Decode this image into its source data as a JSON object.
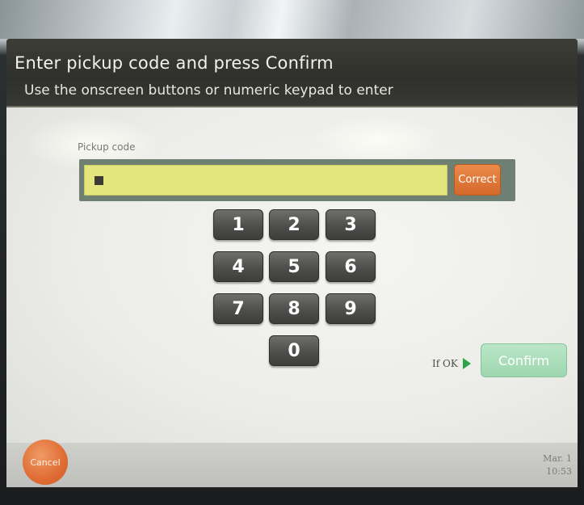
{
  "header": {
    "title": "Enter pickup code and press Confirm",
    "subtitle": "Use the onscreen buttons or numeric keypad to enter"
  },
  "pickup": {
    "label": "Pickup code",
    "value": "",
    "correct_label": "Correct"
  },
  "keypad": {
    "keys": [
      "1",
      "2",
      "3",
      "4",
      "5",
      "6",
      "7",
      "8",
      "9",
      "0"
    ]
  },
  "actions": {
    "if_ok_label": "If OK",
    "confirm_label": "Confirm",
    "cancel_label": "Cancel"
  },
  "status": {
    "date": "Mar. 1",
    "time": "10:53"
  },
  "colors": {
    "input_bg": "#e3e67c",
    "correct_btn": "#e07a3a",
    "confirm_btn": "#a8dcb8",
    "cancel_btn": "#df6c34",
    "key_bg": "#4e4f4c",
    "header_bg": "#33342f"
  },
  "icons": {
    "if_ok_arrow": "play-icon"
  }
}
